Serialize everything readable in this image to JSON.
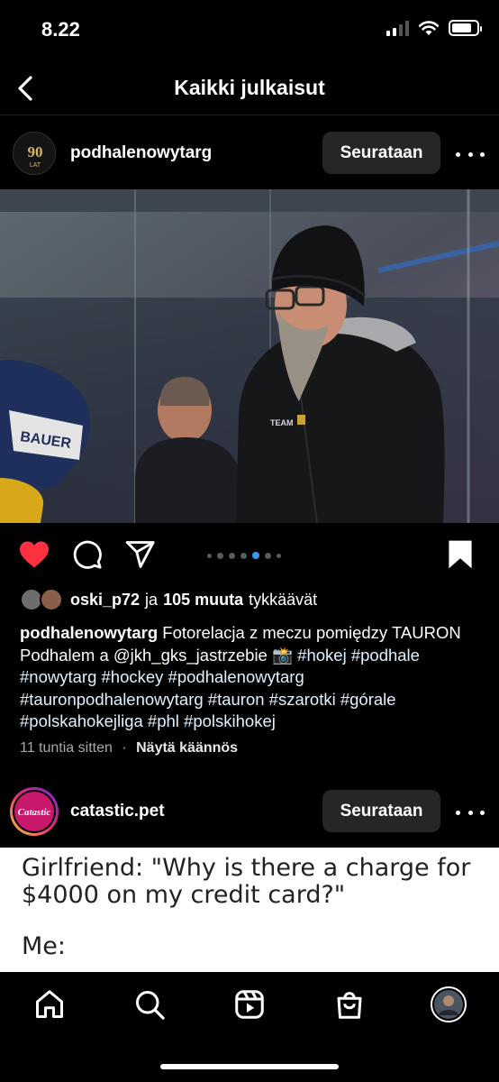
{
  "status_bar": {
    "time": "8.22"
  },
  "header": {
    "title": "Kaikki julkaisut"
  },
  "post1": {
    "avatar_text": "90",
    "avatar_subtext": "LAT",
    "username": "podhalenowytarg",
    "follow_label": "Seurataan",
    "likes": {
      "user": "oski_p72",
      "conj": "ja",
      "others": "105 muuta",
      "suffix": "tykkäävät"
    },
    "caption": {
      "user": "podhalenowytarg",
      "text": "Fotorelacja z meczu pomiędzy TAURON Podhalem a @jkh_gks_jastrzebie 📸",
      "hashtags": "#hokej #podhale #nowytarg #hockey #podhalenowytarg #tauronpodhalenowytarg #tauron #szarotki #górale #polskahokejliga #phl #polskihokej"
    },
    "time_ago": "11 tuntia sitten",
    "separator": "·",
    "translate": "Näytä käännös",
    "carousel": {
      "count": 7,
      "active_index": 4
    },
    "photo_text": {
      "helmet": "BAUER",
      "jacket": "TEAM"
    }
  },
  "post2": {
    "avatar_text": "Catastic",
    "username": "catastic.pet",
    "follow_label": "Seurataan",
    "meme_line1": "Girlfriend: \"Why is there a charge for $4000 on my credit card?\"",
    "meme_line2": "Me:"
  },
  "tabs": [
    "home-icon",
    "search-icon",
    "reels-icon",
    "shop-icon",
    "profile-avatar"
  ],
  "colors": {
    "like_red": "#ff3040",
    "dot_active": "#3897f0",
    "button_bg": "#262626"
  }
}
